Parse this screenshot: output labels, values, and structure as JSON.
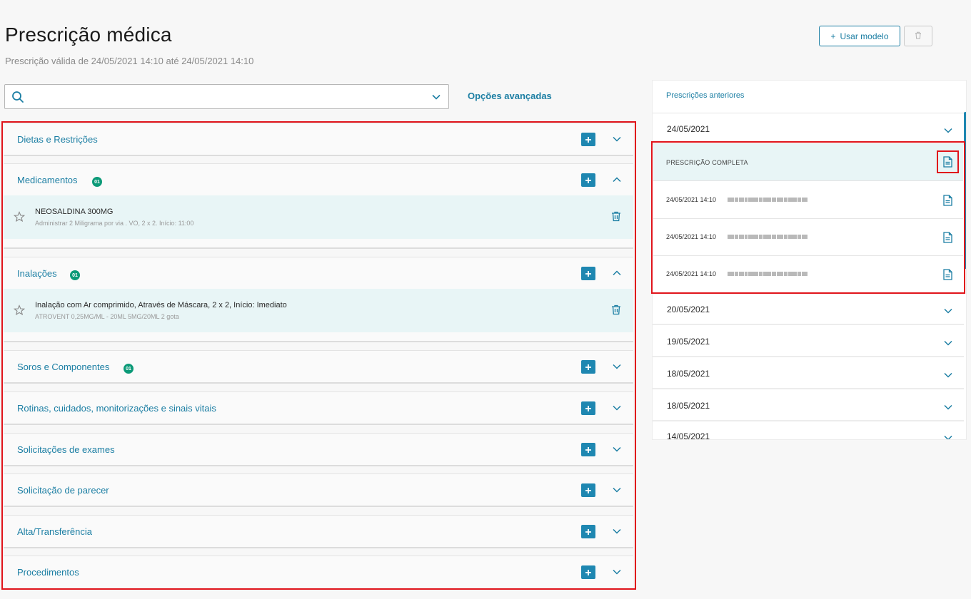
{
  "header": {
    "title": "Prescrição médica",
    "subtitle": "Prescrição válida de 24/05/2021 14:10 até 24/05/2021 14:10",
    "use_model_label": "Usar modelo",
    "use_model_prefix": "+"
  },
  "search": {
    "value": "",
    "placeholder": "",
    "advanced_label": "Opções avançadas"
  },
  "sections": [
    {
      "title": "Dietas e Restrições",
      "badge": "",
      "expanded": false
    },
    {
      "title": "Medicamentos",
      "badge": "01",
      "expanded": true,
      "items": [
        {
          "name": "NEOSALDINA 300MG",
          "description": "Administrar 2 Miligrama por via . VO, 2 x 2. Início: 11:00"
        }
      ]
    },
    {
      "title": "Inalações",
      "badge": "01",
      "expanded": true,
      "items": [
        {
          "name": "Inalação com Ar comprimido, Através de Máscara, 2 x 2, Início: Imediato",
          "description": "ATROVENT 0,25MG/ML - 20ML 5MG/20ML 2 gota"
        }
      ]
    },
    {
      "title": "Soros e Componentes",
      "badge": "01",
      "expanded": false
    },
    {
      "title": "Rotinas, cuidados, monitorizações e sinais vitais",
      "badge": "",
      "expanded": false
    },
    {
      "title": "Solicitações de exames",
      "badge": "",
      "expanded": false
    },
    {
      "title": "Solicitação de parecer",
      "badge": "",
      "expanded": false
    },
    {
      "title": "Alta/Transferência",
      "badge": "",
      "expanded": false
    },
    {
      "title": "Procedimentos",
      "badge": "",
      "expanded": false
    }
  ],
  "previous": {
    "title": "Prescrições anteriores",
    "expanded_date": "24/05/2021",
    "complete_label": "PRESCRIÇÃO COMPLETA",
    "entries": [
      {
        "time": "24/05/2021 14:10"
      },
      {
        "time": "24/05/2021 14:10"
      },
      {
        "time": "24/05/2021 14:10"
      }
    ],
    "other_dates": [
      "20/05/2021",
      "19/05/2021",
      "18/05/2021",
      "18/05/2021",
      "14/05/2021"
    ]
  },
  "colors": {
    "accent": "#1b7ea3",
    "plus_button": "#1e87b1",
    "badge": "#0c9a78",
    "highlight_border": "#e0141b",
    "selected_row": "#e8f5f6"
  }
}
